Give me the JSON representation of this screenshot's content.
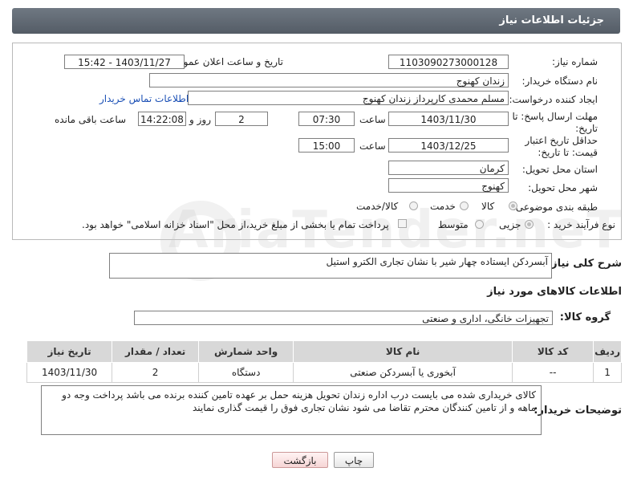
{
  "header": {
    "title": "جزئیات اطلاعات نیاز"
  },
  "form": {
    "need_number_label": "شماره نیاز:",
    "need_number": "1103090273000128",
    "announce_label": "تاریخ و ساعت اعلان عمومی:",
    "announce_value": "1403/11/27 - 15:42",
    "buyer_org_label": "نام دستگاه خریدار:",
    "buyer_org": "زندان کهنوج",
    "creator_label": "ایجاد کننده درخواست:",
    "creator": "مسلم محمدی کارپرداز زندان کهنوج",
    "contact_link": "اطلاعات تماس خریدار",
    "reply_deadline_label": "مهلت ارسال پاسخ: تا تاریخ:",
    "reply_date": "1403/11/30",
    "time_label": "ساعت",
    "reply_time": "07:30",
    "days_value": "2",
    "days_label": "روز و",
    "remaining_time": "14:22:08",
    "remaining_label": "ساعت باقی مانده",
    "price_validity_label": "حداقل تاریخ اعتبار قیمت: تا تاریخ:",
    "price_date": "1403/12/25",
    "price_time_label": "ساعت",
    "price_time": "15:00",
    "province_label": "استان محل تحویل:",
    "province": "کرمان",
    "city_label": "شهر محل تحویل:",
    "city": "کهنوج",
    "category_label": "طبقه بندی موضوعی:",
    "category_options": [
      "کالا",
      "خدمت",
      "کالا/خدمت"
    ],
    "process_label": "نوع فرآیند خرید :",
    "process_options": [
      "جزیی",
      "متوسط"
    ],
    "payment_note": "پرداخت تمام یا بخشی از مبلغ خرید،از محل \"اسناد خزانه اسلامی\" خواهد بود."
  },
  "description": {
    "label": "شرح کلی نیاز:",
    "value": "آبسردکن ایستاده چهار شیر با نشان تجاری  الکترو استیل"
  },
  "goods_info": {
    "title": "اطلاعات کالاهای مورد نیاز",
    "group_label": "گروه کالا:",
    "group_value": "تجهیزات خانگی، اداری و صنعتی"
  },
  "table": {
    "headers": [
      "ردیف",
      "کد کالا",
      "نام کالا",
      "واحد شمارش",
      "تعداد / مقدار",
      "تاریخ نیاز"
    ],
    "rows": [
      [
        "1",
        "--",
        "آبخوری یا آبسردکن صنعتی",
        "دستگاه",
        "2",
        "1403/11/30"
      ]
    ]
  },
  "buyer_notes": {
    "label": "توضیحات خریدار:",
    "value": "کالای خریداری شده می بایست درب اداره زندان تحویل هزینه حمل بر عهده تامین کننده برنده می باشد پرداخت وجه دو ماهه و از تامین کنندگان محترم تقاضا می شود نشان تجاری فوق را قیمت گذاری نمایند"
  },
  "buttons": {
    "print": "چاپ",
    "back": "بازگشت"
  },
  "watermark": "AriaTender.neT"
}
